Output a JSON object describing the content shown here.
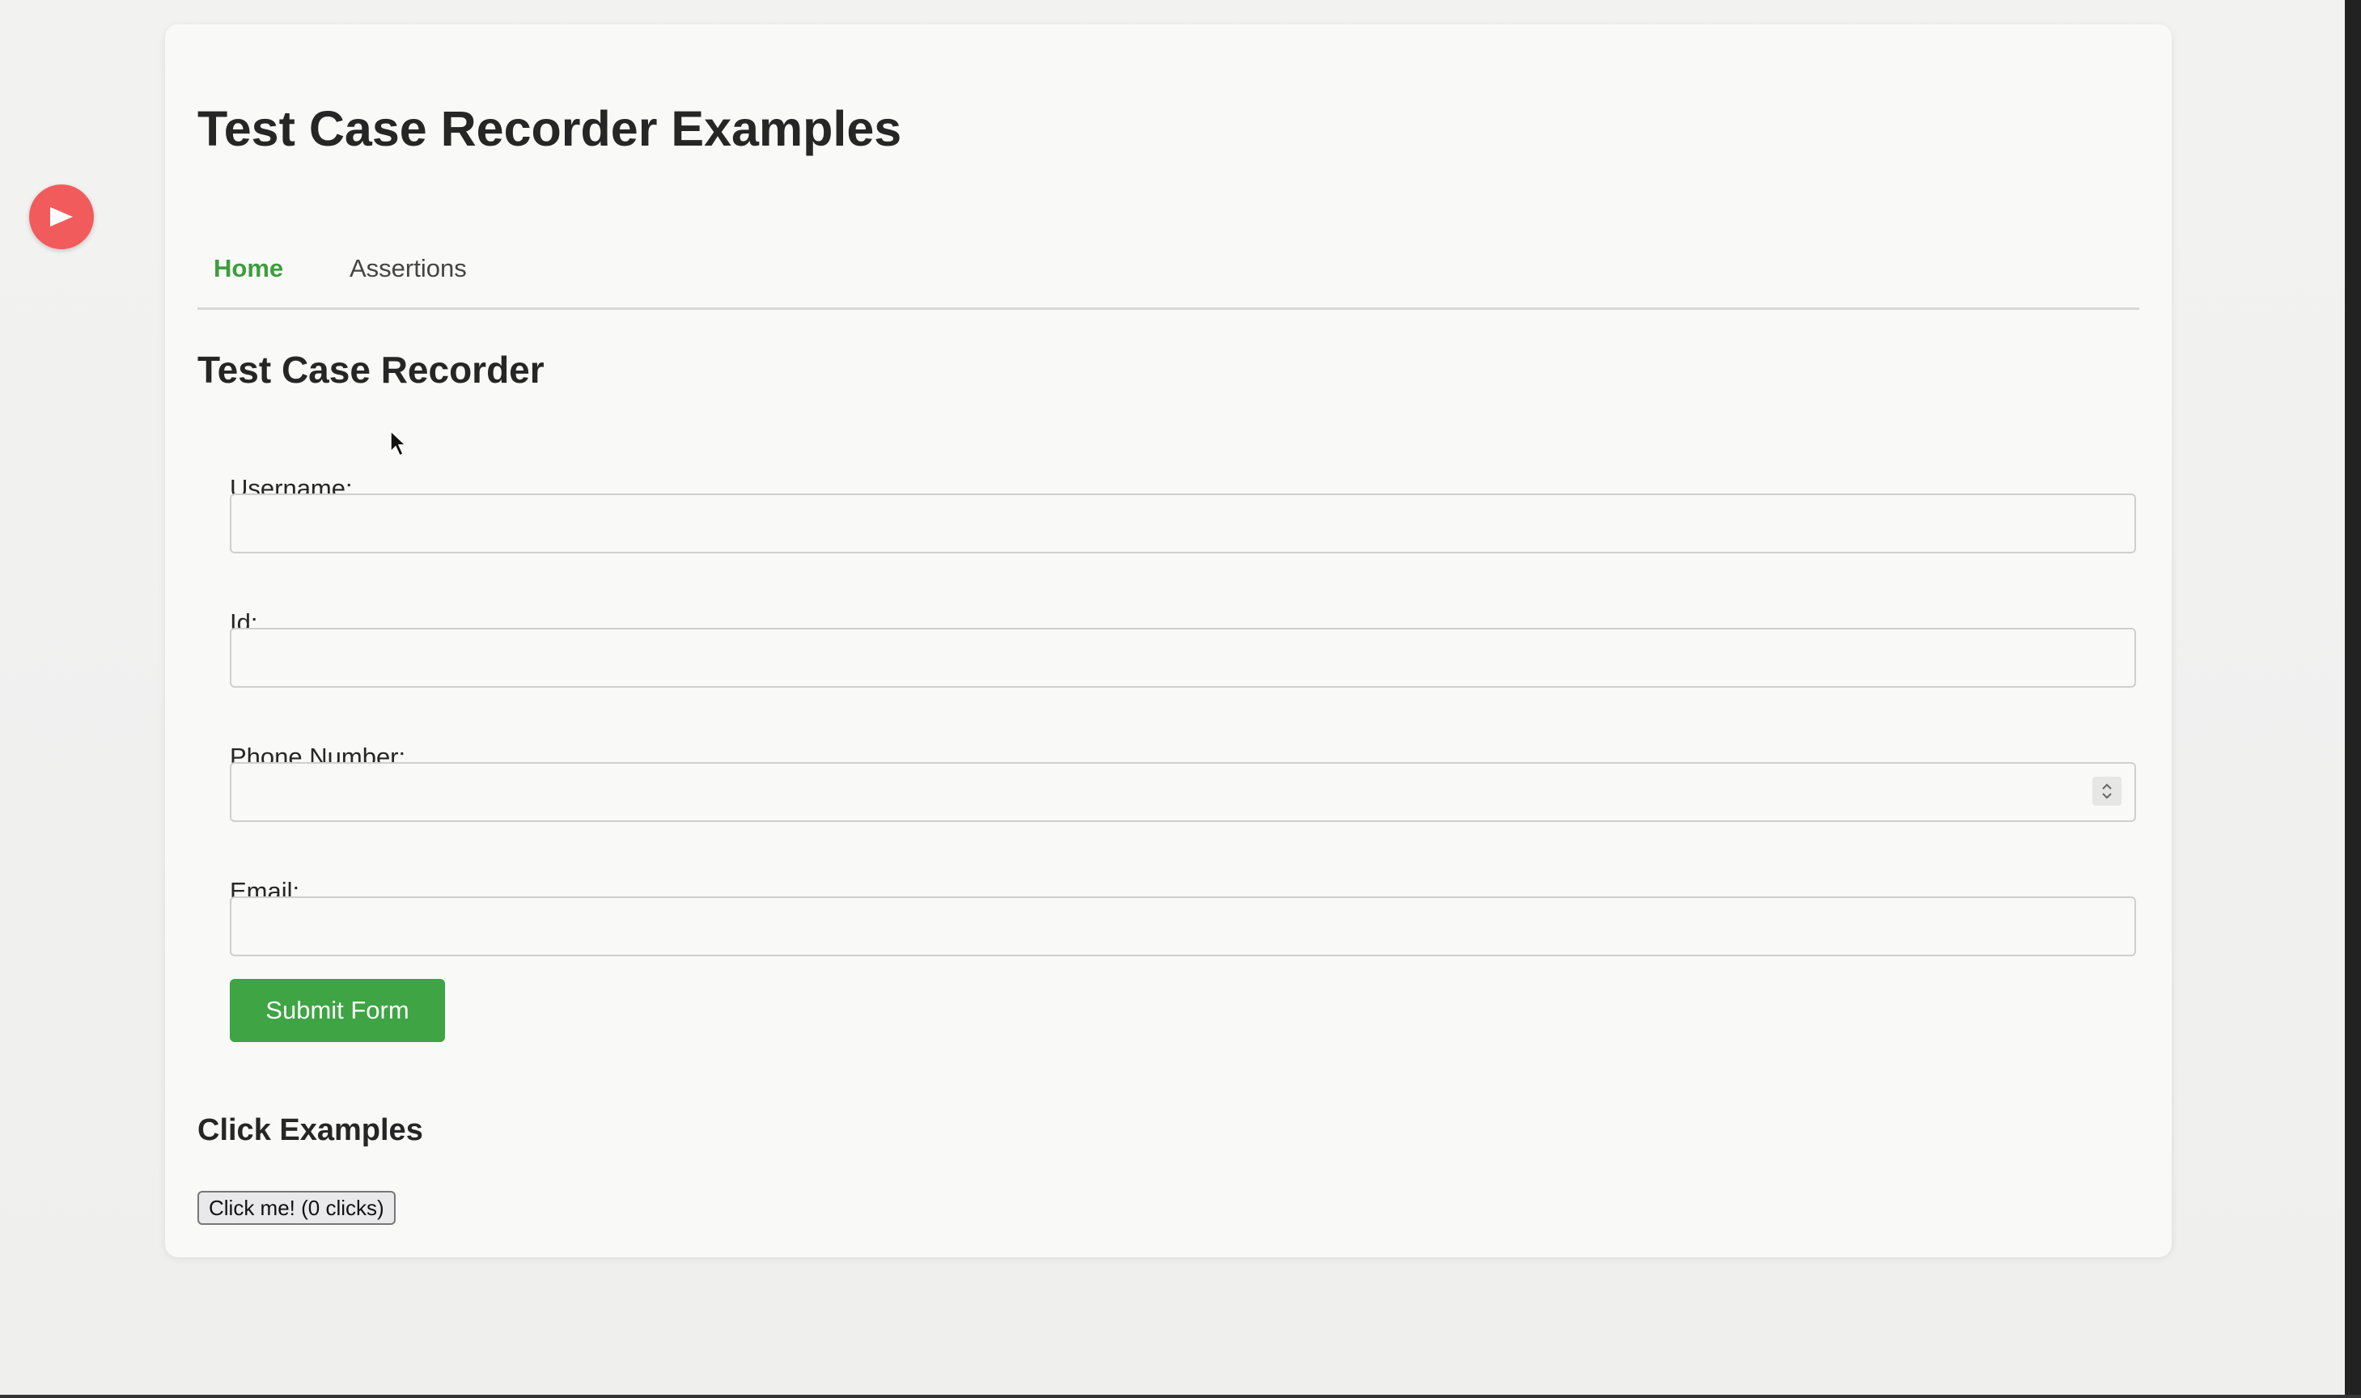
{
  "app": {
    "title": "Test Case Recorder Examples"
  },
  "colors": {
    "accent_green": "#3ea444",
    "record_red": "#f25b5b",
    "active_tab": "#3c9e3c"
  },
  "recorder": {
    "icon": "play-icon"
  },
  "tabs": [
    {
      "label": "Home",
      "active": true
    },
    {
      "label": "Assertions",
      "active": false
    }
  ],
  "form": {
    "title": "Test Case Recorder",
    "fields": [
      {
        "label": "Username:",
        "value": "",
        "type": "text"
      },
      {
        "label": "Id:",
        "value": "",
        "type": "text"
      },
      {
        "label": "Phone Number:",
        "value": "",
        "type": "number"
      },
      {
        "label": "Email:",
        "value": "",
        "type": "email"
      }
    ],
    "submit_label": "Submit Form"
  },
  "click_examples": {
    "title": "Click Examples",
    "button_label": "Click me! (0 clicks)"
  }
}
